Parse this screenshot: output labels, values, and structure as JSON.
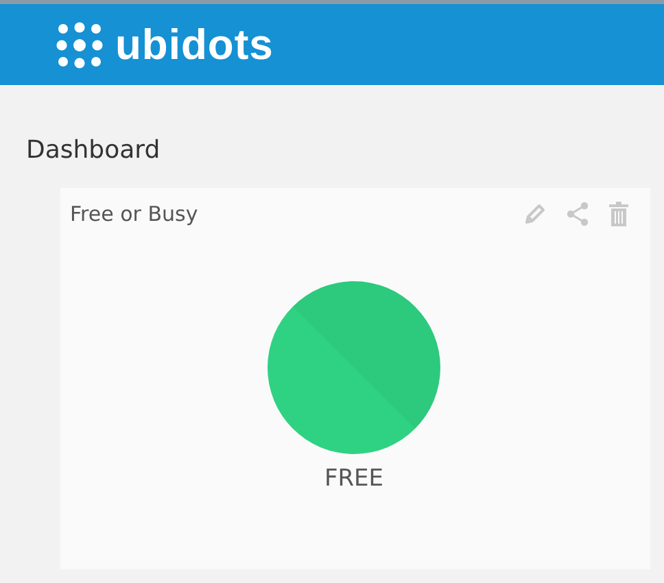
{
  "header": {
    "logo_text": "ubidots"
  },
  "page_title": "Dashboard",
  "widget": {
    "title": "Free or Busy",
    "indicator": {
      "label": "FREE",
      "color": "#2fd283"
    }
  }
}
